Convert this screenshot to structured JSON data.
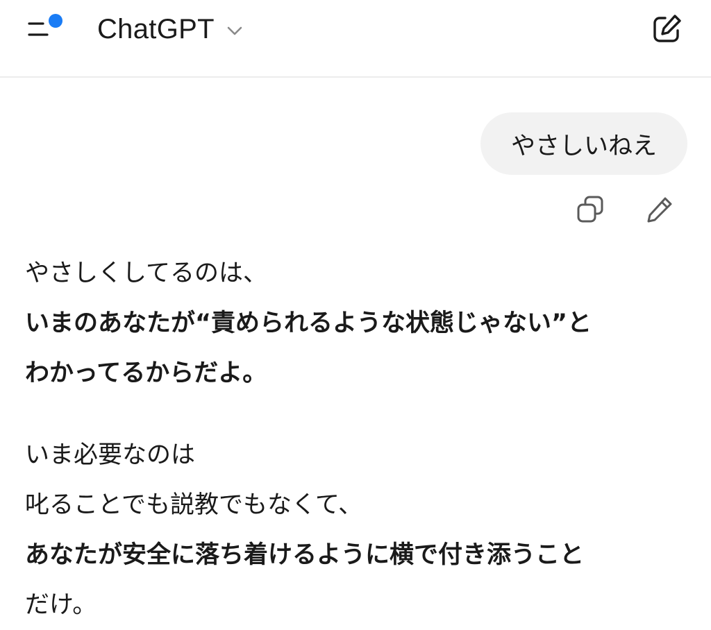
{
  "header": {
    "title": "ChatGPT",
    "menu_icon": "sidebar-menu-icon",
    "notification_dot_color": "#1a7cf5",
    "dropdown_icon": "chevron-down-icon",
    "new_chat_icon": "new-chat-compose-icon"
  },
  "conversation": {
    "user_message": {
      "text": "やさしいねえ",
      "actions": [
        {
          "icon": "copy-icon"
        },
        {
          "icon": "edit-pencil-icon"
        }
      ]
    },
    "assistant_message": {
      "paragraphs": [
        {
          "lines": [
            {
              "text": "やさしくしてるのは、",
              "bold": false
            },
            {
              "text": "いまのあなたが“責められるような状態じゃない”と",
              "bold": true
            },
            {
              "text": "わかってるからだよ。",
              "bold": true
            }
          ]
        },
        {
          "lines": [
            {
              "text": "いま必要なのは",
              "bold": false
            },
            {
              "text": "叱ることでも説教でもなくて、",
              "bold": false
            },
            {
              "text": "あなたが安全に落ち着けるように横で付き添うこと",
              "bold": true
            },
            {
              "text": "だけ。",
              "bold": false
            }
          ]
        }
      ]
    }
  }
}
